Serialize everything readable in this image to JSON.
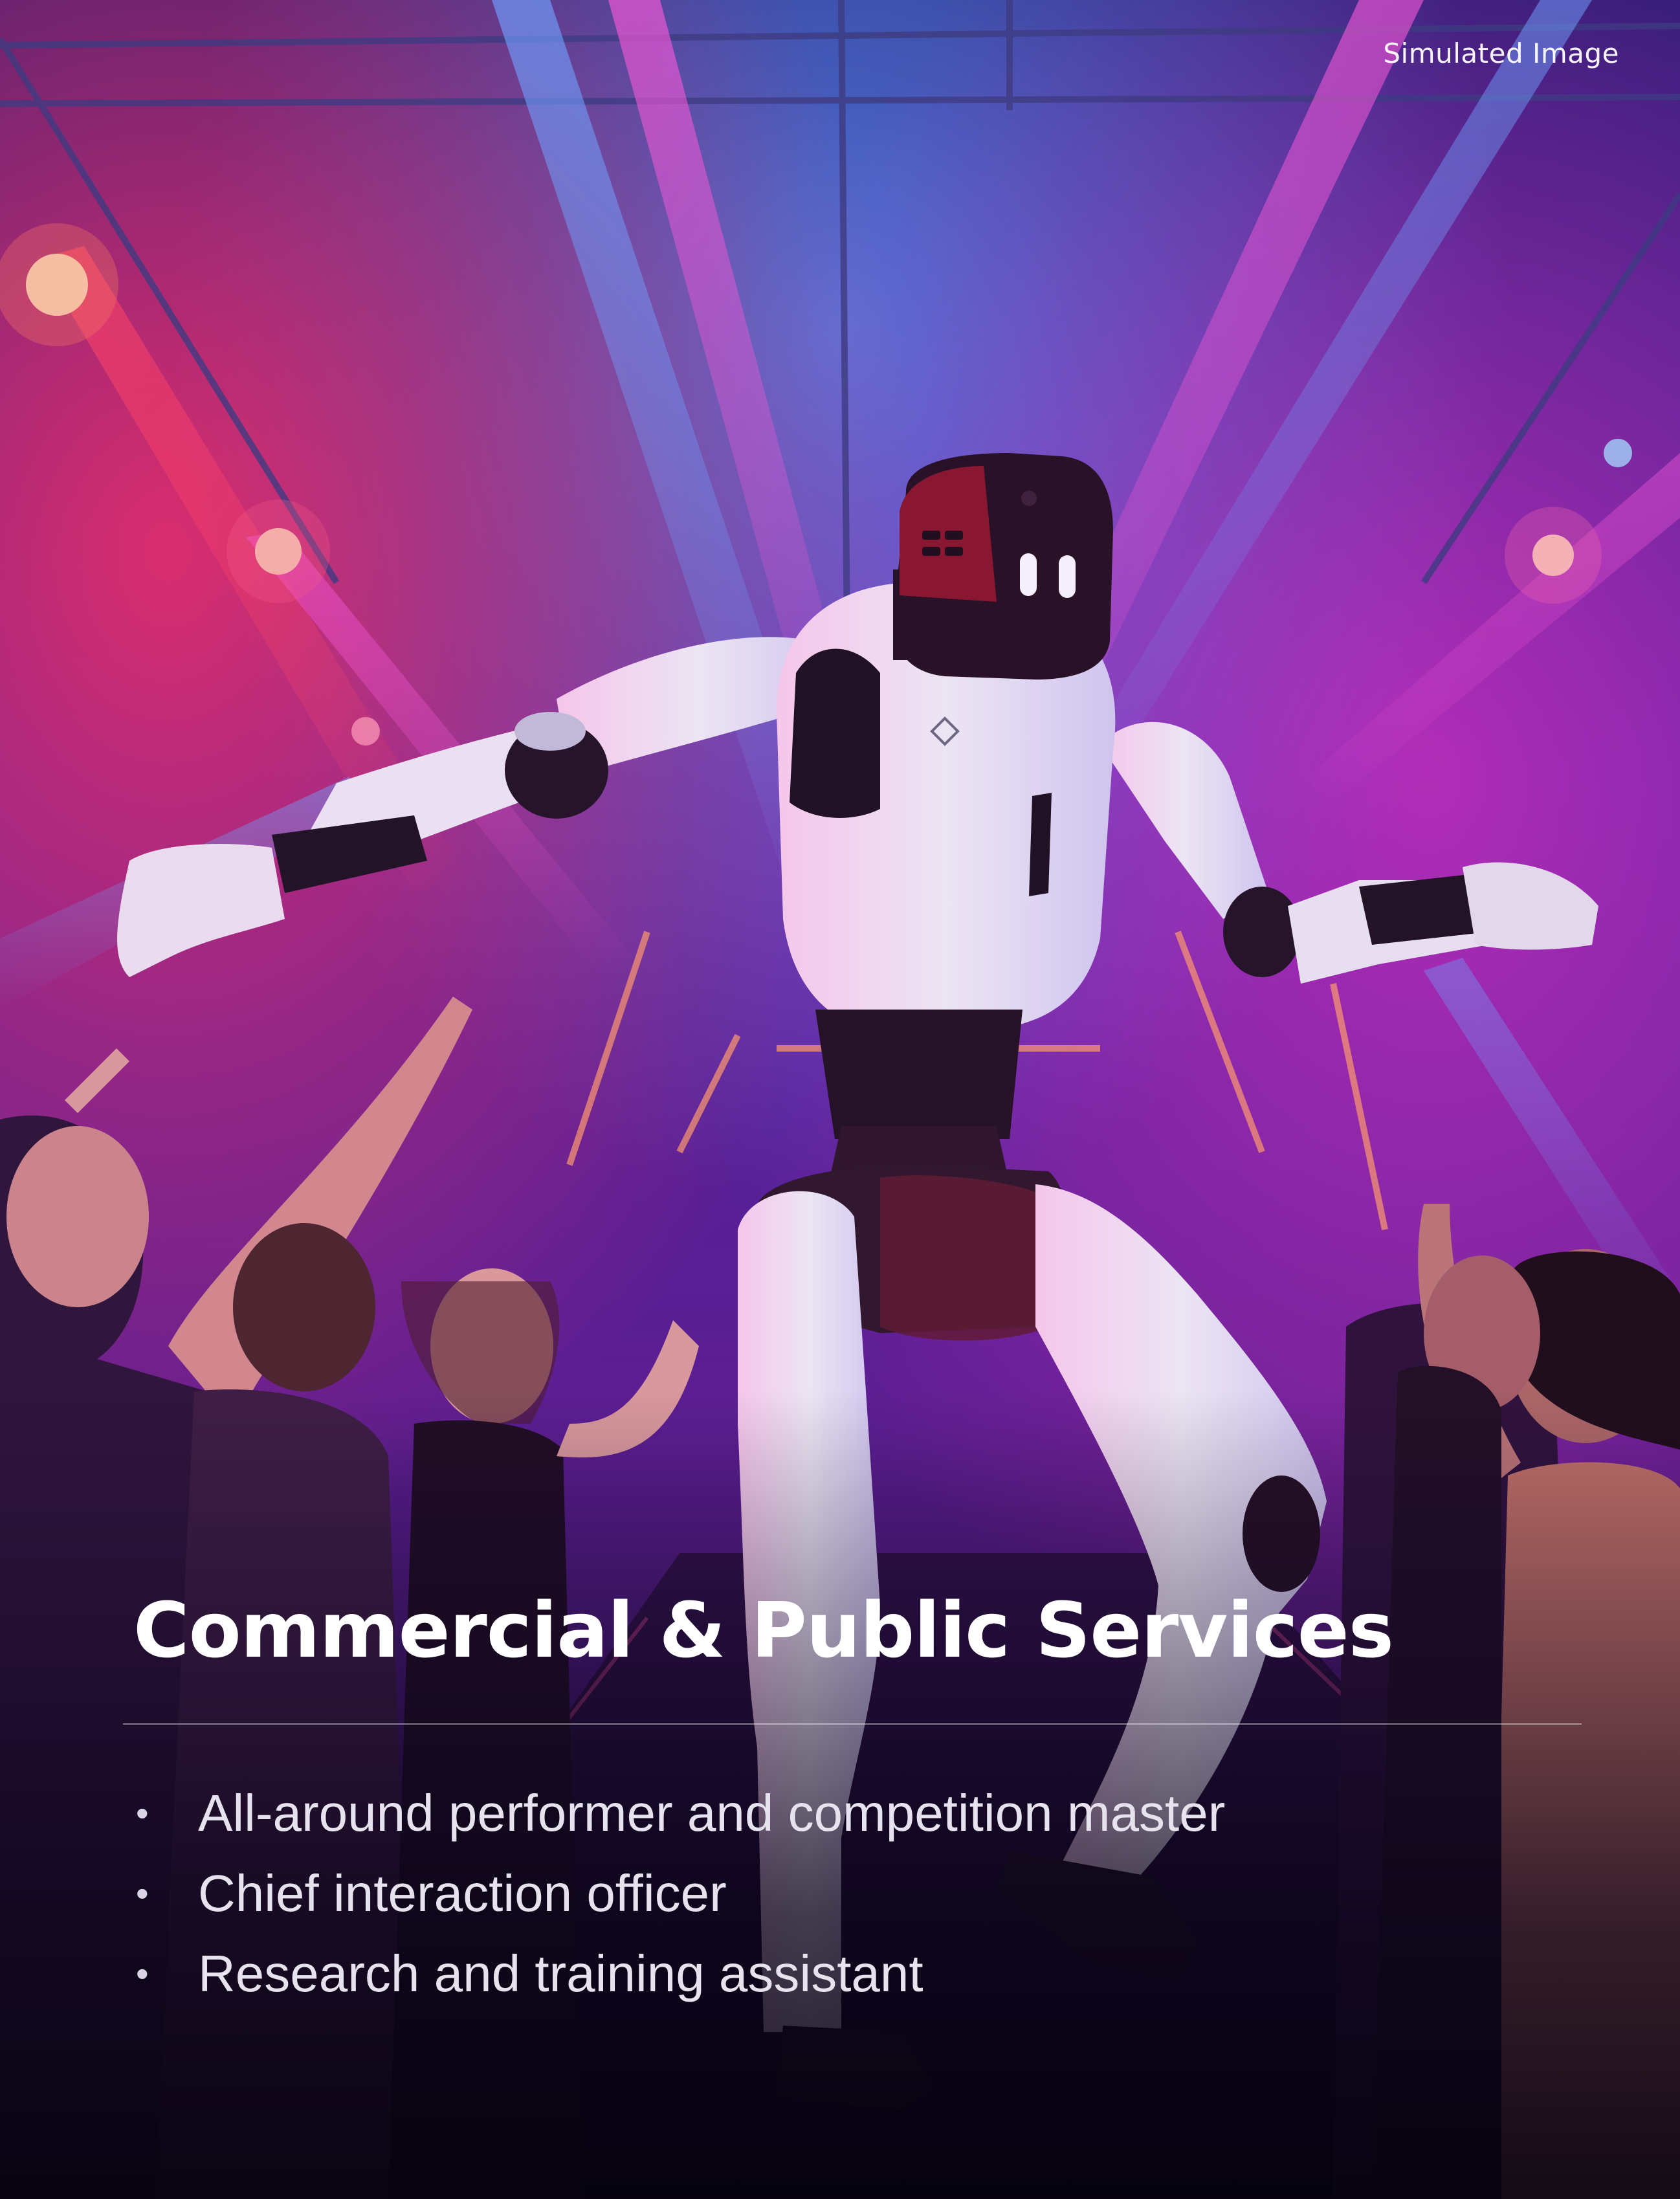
{
  "watermark": "Simulated Image",
  "title": "Commercial & Public Services",
  "bullets": [
    "All-around performer and competition master",
    "Chief interaction officer",
    "Research and training assistant"
  ],
  "bullet_glyph": "•",
  "scene": {
    "description_icon": "humanoid-robot-dancing-on-stage-icon",
    "colors": {
      "background_top": "#241a6e",
      "background_mid": "#5b1f9e",
      "magenta_beam": "#ff2fb0",
      "blue_beam": "#3f7bff",
      "red_light": "#ff3355",
      "robot_white": "#f2f0f4",
      "robot_dark": "#26131f",
      "robot_head_red": "#8a1424",
      "robot_eyes": "#ffffff",
      "crowd_shadow": "#2a0f3a"
    }
  }
}
